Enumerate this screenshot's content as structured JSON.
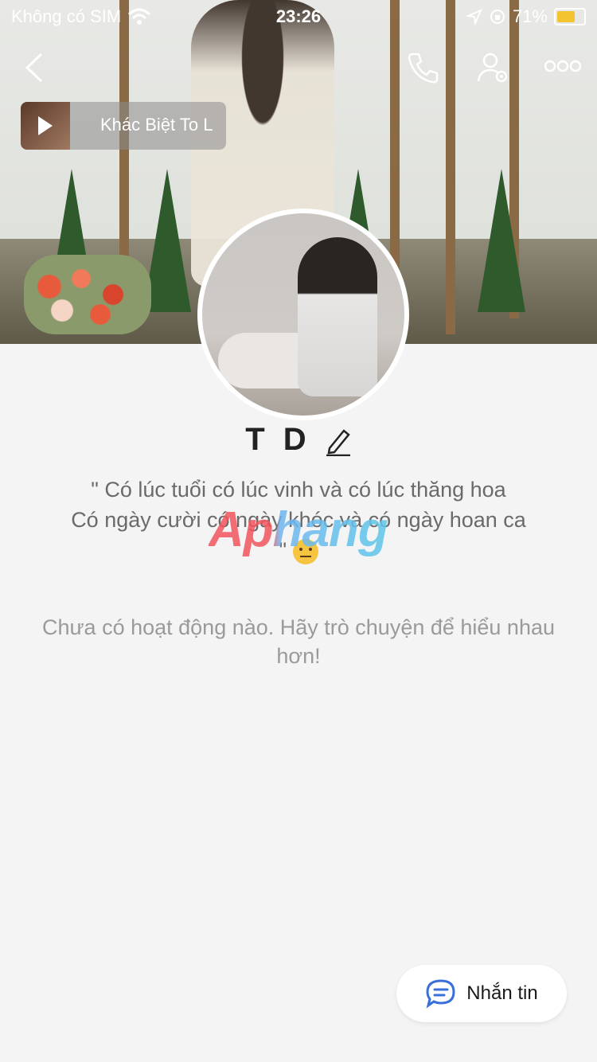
{
  "status_bar": {
    "carrier": "Không có SIM",
    "time": "23:26",
    "battery": "71%"
  },
  "music": {
    "title": "Khác Biệt To L"
  },
  "profile": {
    "name": "T D",
    "bio_line1": "\" Có lúc tuổi có lúc vinh và có lúc thăng hoa",
    "bio_line2": "Có ngày cười có ngày khóc và có ngày hoan ca",
    "bio_line3": "\""
  },
  "watermark": "Aphang",
  "empty_state": "Chưa có hoạt động nào. Hãy trò chuyện để hiểu nhau hơn!",
  "message_button": {
    "label": "Nhắn tin"
  },
  "colors": {
    "accent": "#3a6fd8",
    "battery": "#f4c430"
  },
  "icons": [
    "wifi-icon",
    "location-icon",
    "lock-rotation-icon",
    "battery-icon",
    "back-icon",
    "phone-icon",
    "user-settings-icon",
    "more-icon",
    "play-icon",
    "edit-icon",
    "chat-icon"
  ]
}
